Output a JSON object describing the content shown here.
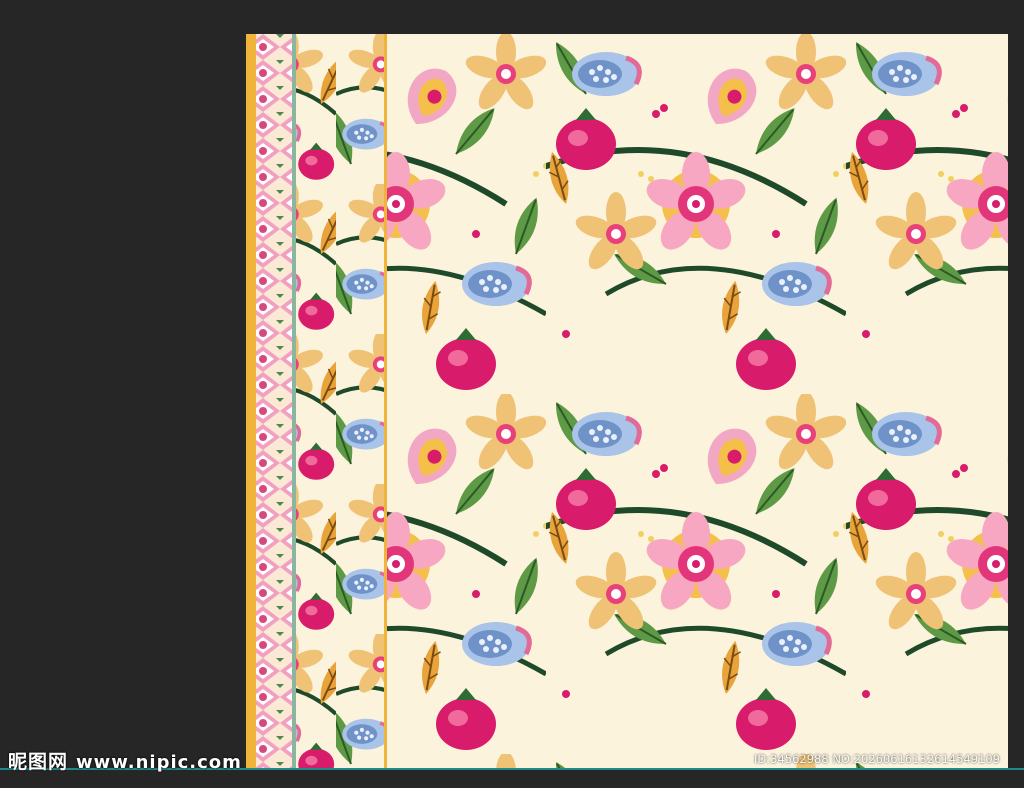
{
  "watermark": {
    "site_name": "昵图网",
    "site_url": "www.nipic.com",
    "image_id": "ID:34562988 NO:20260616132614549109"
  },
  "artwork": {
    "description_colors": {
      "background": "#fbf3dc",
      "gold_stripe": "#f0b33c",
      "magenta": "#d81b6a",
      "pink": "#f28bb0",
      "yellow": "#f5c04a",
      "blue": "#8fb2dd",
      "green": "#5e9a45",
      "dark_green": "#1f4a2a"
    },
    "icons": [
      "flower-motif-icon",
      "leaf-icon",
      "pomegranate-icon"
    ]
  }
}
